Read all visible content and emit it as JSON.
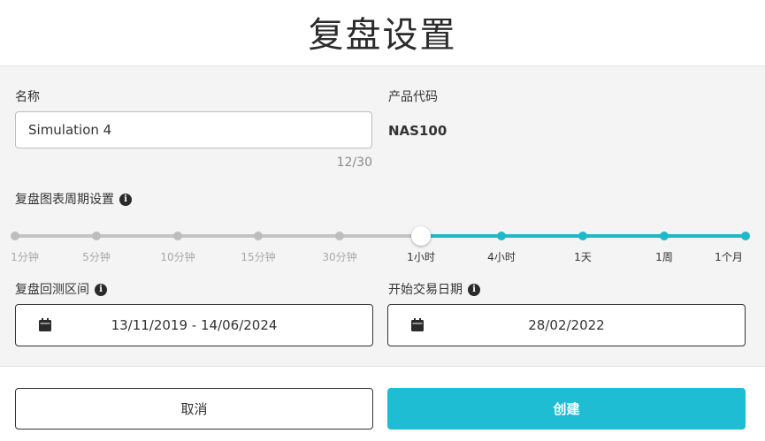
{
  "dialog": {
    "title": "复盘设置"
  },
  "form": {
    "name_label": "名称",
    "name_value": "Simulation 4",
    "name_counter": "12/30",
    "product_label": "产品代码",
    "product_value": "NAS100",
    "period_label": "复盘图表周期设置",
    "range_label": "复盘回测区间",
    "range_value": "13/11/2019 - 14/06/2024",
    "start_label": "开始交易日期",
    "start_value": "28/02/2022"
  },
  "slider": {
    "labels": [
      "1分钟",
      "5分钟",
      "10分钟",
      "15分钟",
      "30分钟",
      "1小时",
      "4小时",
      "1天",
      "1周",
      "1个月"
    ],
    "selected_index": 5,
    "active_color": "#1fb8c9",
    "inactive_color": "#c4c4c4"
  },
  "footer": {
    "cancel_label": "取消",
    "create_label": "创建"
  },
  "colors": {
    "accent": "#1fbdd3"
  },
  "icons": {
    "info": "info-circle-icon",
    "calendar": "calendar-icon"
  }
}
